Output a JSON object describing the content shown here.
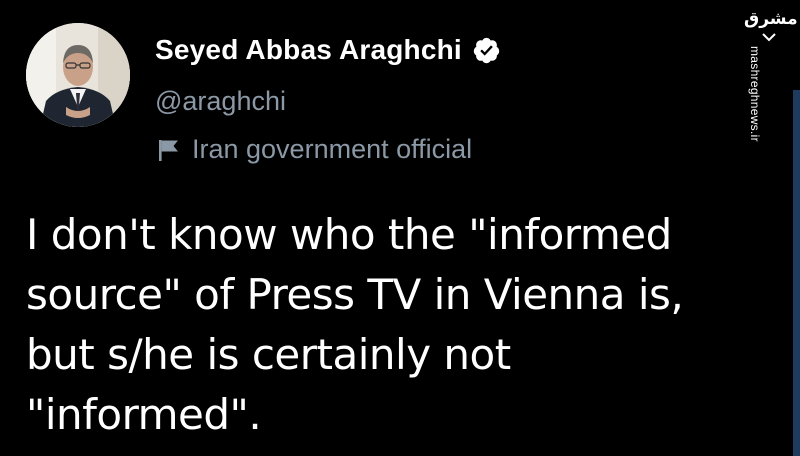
{
  "profile": {
    "display_name": "Seyed Abbas Araghchi",
    "handle": "@araghchi",
    "account_label": "Iran government official",
    "verified_icon": "verified-badge-icon",
    "label_icon": "flag-icon"
  },
  "tweet": {
    "text": "I don't know who the \"informed source\" of Press TV in Vienna is, but s/he is certainly not \"informed\"."
  },
  "watermark": {
    "logo_text": "مشرق",
    "url": "mashreghnews.ir"
  },
  "colors": {
    "background": "#000000",
    "primary_text": "#ffffff",
    "secondary_text": "#8b98a5",
    "verified_badge": "#ffffff"
  }
}
